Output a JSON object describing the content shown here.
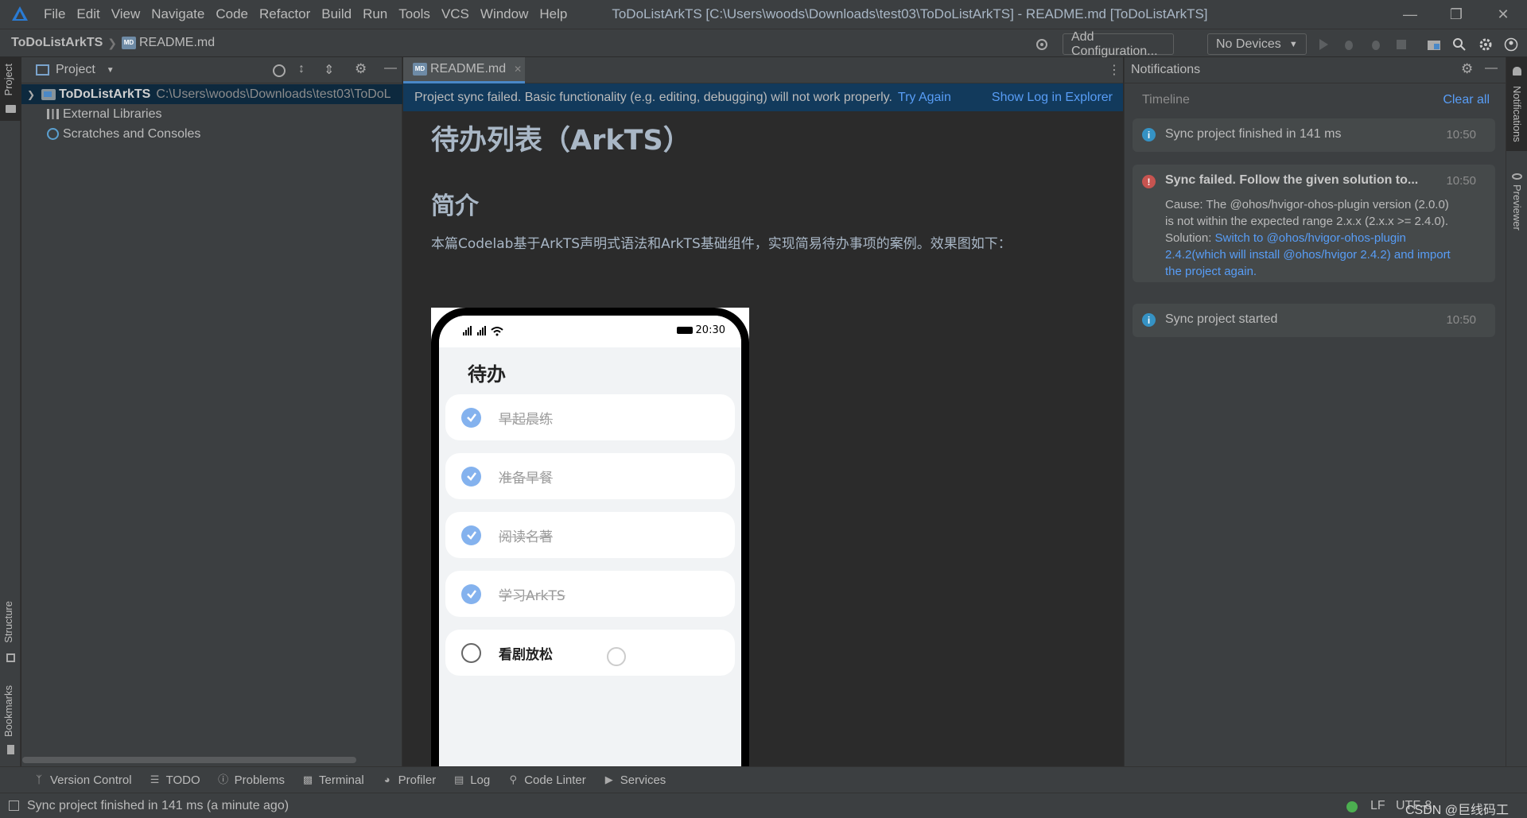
{
  "titlebar": {
    "menu": [
      "File",
      "Edit",
      "View",
      "Navigate",
      "Code",
      "Refactor",
      "Build",
      "Run",
      "Tools",
      "VCS",
      "Window",
      "Help"
    ],
    "window_title": "ToDoListArkTS [C:\\Users\\woods\\Downloads\\test03\\ToDoListArkTS] - README.md [ToDoListArkTS]"
  },
  "navbar": {
    "project": "ToDoListArkTS",
    "file": "README.md",
    "add_configuration": "Add Configuration...",
    "devices": "No Devices"
  },
  "project_panel": {
    "title": "Project",
    "tree": [
      {
        "label": "ToDoListArkTS",
        "path": "C:\\Users\\woods\\Downloads\\test03\\ToDoL"
      },
      {
        "label": "External Libraries"
      },
      {
        "label": "Scratches and Consoles"
      }
    ]
  },
  "left_stripe": {
    "project": "Project",
    "structure": "Structure",
    "bookmarks": "Bookmarks"
  },
  "right_stripe": {
    "notifications": "Notifications",
    "previewer": "Previewer"
  },
  "editor": {
    "tab": "README.md",
    "banner": {
      "message": "Project sync failed. Basic functionality (e.g. editing, debugging) will not work properly.",
      "try_again": "Try Again",
      "show_log": "Show Log in Explorer"
    },
    "markdown": {
      "h1": "待办列表（ArkTS）",
      "h2": "简介",
      "paragraph": "本篇Codelab基于ArkTS声明式语法和ArkTS基础组件，实现简易待办事项的案例。效果图如下："
    },
    "phone": {
      "status_time": "20:30",
      "title": "待办",
      "items": [
        {
          "text": "早起晨练",
          "done": true
        },
        {
          "text": "准备早餐",
          "done": true
        },
        {
          "text": "阅读名著",
          "done": true
        },
        {
          "text": "学习ArkTS",
          "done": true
        },
        {
          "text": "看剧放松",
          "done": false
        }
      ]
    }
  },
  "notifications": {
    "title": "Notifications",
    "timeline": "Timeline",
    "clear_all": "Clear all",
    "items": [
      {
        "type": "info",
        "title": "Sync project finished in 141 ms",
        "time": "10:50"
      },
      {
        "type": "error",
        "title": "Sync failed. Follow the given solution to...",
        "time": "10:50",
        "cause_1": "Cause: The @ohos/hvigor-ohos-plugin version (2.0.0)",
        "cause_2": "is not within the expected range 2.x.x (2.x.x >= 2.4.0).",
        "solution_label": "Solution: ",
        "solution_link_1": "Switch to @ohos/hvigor-ohos-plugin",
        "solution_link_2": "2.4.2(which will install @ohos/hvigor 2.4.2) and import",
        "solution_link_3": "the project again."
      },
      {
        "type": "info",
        "title": "Sync project started",
        "time": "10:50"
      }
    ]
  },
  "bottom_tabs": [
    "Version Control",
    "TODO",
    "Problems",
    "Terminal",
    "Profiler",
    "Log",
    "Code Linter",
    "Services"
  ],
  "status": {
    "message": "Sync project finished in 141 ms (a minute ago)",
    "line_sep": "LF",
    "encoding": "UTF-8",
    "watermark": "CSDN @巨线码工"
  },
  "colors": {
    "accent": "#4a88c7",
    "link": "#589df6",
    "error": "#c75450",
    "info": "#3592c4",
    "done_check": "#84b2ee"
  }
}
